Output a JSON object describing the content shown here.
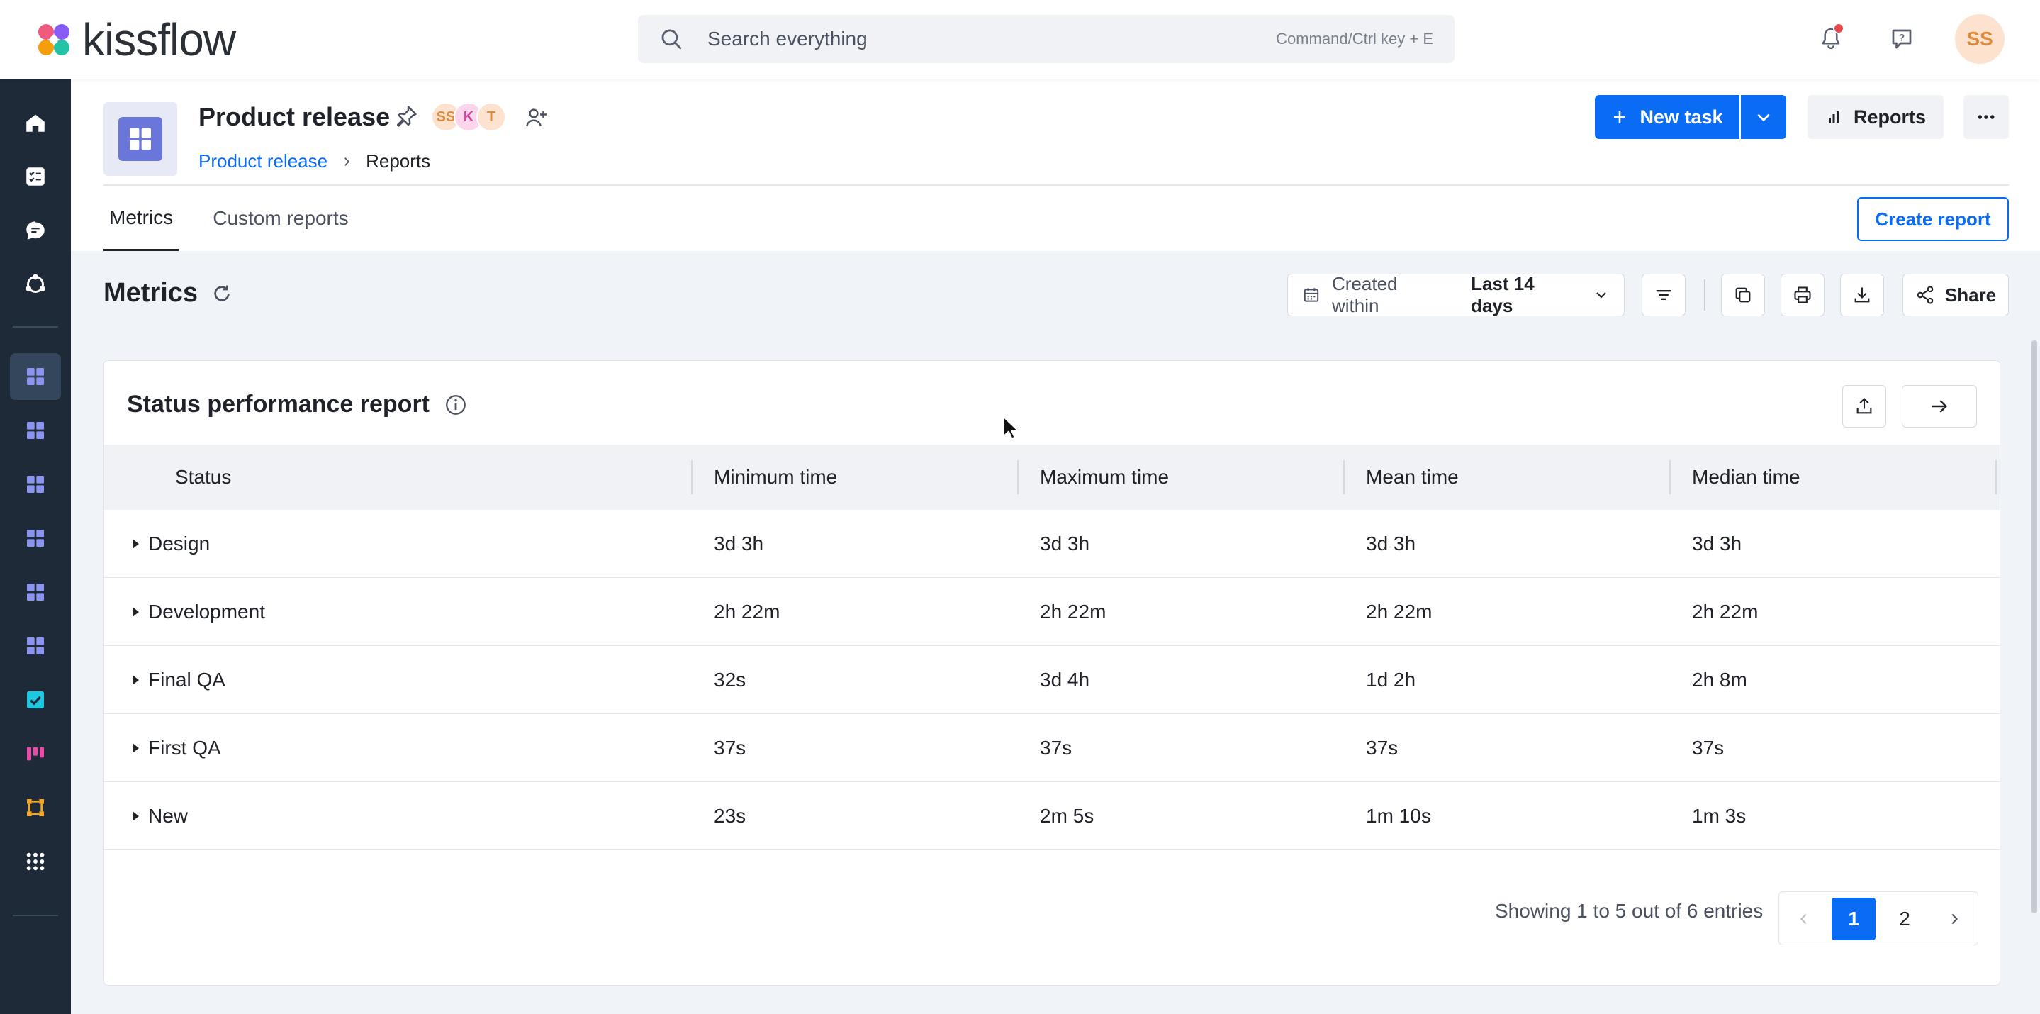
{
  "brand": {
    "name": "kissflow"
  },
  "search": {
    "placeholder": "Search everything",
    "shortcut": "Command/Ctrl key + E"
  },
  "user": {
    "initials": "SS"
  },
  "sidebar": {
    "items": [
      {
        "icon": "home-icon"
      },
      {
        "icon": "tasks-icon"
      },
      {
        "icon": "chat-icon"
      },
      {
        "icon": "process-icon"
      },
      {
        "icon": "grid-icon",
        "active": true
      },
      {
        "icon": "grid-icon"
      },
      {
        "icon": "grid-icon"
      },
      {
        "icon": "grid-icon"
      },
      {
        "icon": "grid-icon"
      },
      {
        "icon": "grid-icon"
      },
      {
        "icon": "checkbox-icon"
      },
      {
        "icon": "board-icon"
      },
      {
        "icon": "integration-icon"
      },
      {
        "icon": "apps-icon"
      }
    ],
    "add_label": "+"
  },
  "project": {
    "title": "Product release",
    "members": [
      "SS",
      "K",
      "T"
    ],
    "breadcrumb": {
      "parent": "Product release",
      "current": "Reports"
    }
  },
  "actions": {
    "new_task": "New task",
    "reports": "Reports"
  },
  "tabs": {
    "metrics": "Metrics",
    "custom": "Custom reports",
    "create_report": "Create report"
  },
  "metrics": {
    "title": "Metrics",
    "filter_label": "Created within",
    "filter_value": "Last 14 days",
    "share_label": "Share"
  },
  "report": {
    "title": "Status performance report",
    "columns": [
      "Status",
      "Minimum time",
      "Maximum time",
      "Mean time",
      "Median time"
    ],
    "rows": [
      [
        "Design",
        "3d 3h",
        "3d 3h",
        "3d 3h",
        "3d 3h"
      ],
      [
        "Development",
        "2h 22m",
        "2h 22m",
        "2h 22m",
        "2h 22m"
      ],
      [
        "Final QA",
        "32s",
        "3d 4h",
        "1d 2h",
        "2h 8m"
      ],
      [
        "First QA",
        "37s",
        "37s",
        "37s",
        "37s"
      ],
      [
        "New",
        "23s",
        "2m 5s",
        "1m 10s",
        "1m 3s"
      ]
    ],
    "pagination": {
      "summary": "Showing 1 to 5 out of 6 entries",
      "pages": [
        "1",
        "2"
      ],
      "current": "1"
    }
  },
  "colors": {
    "accent": "#0a6cf5",
    "sidebar": "#1e2a38",
    "app_icon": "#6a76d9"
  }
}
